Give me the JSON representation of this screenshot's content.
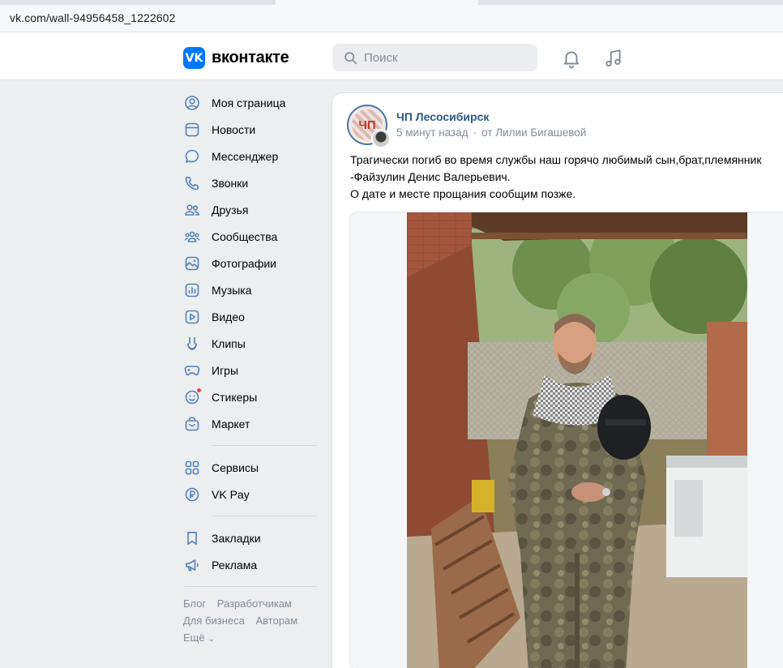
{
  "browser": {
    "url": "vk.com/wall-94956458_1222602"
  },
  "header": {
    "logo_mark": "VK",
    "logo_text": "вконтакте",
    "search_placeholder": "Поиск"
  },
  "sidebar": {
    "items": [
      {
        "label": "Моя страница",
        "icon": "user-circle-icon"
      },
      {
        "label": "Новости",
        "icon": "news-icon"
      },
      {
        "label": "Мессенджер",
        "icon": "message-icon"
      },
      {
        "label": "Звонки",
        "icon": "phone-icon"
      },
      {
        "label": "Друзья",
        "icon": "friends-icon"
      },
      {
        "label": "Сообщества",
        "icon": "communities-icon"
      },
      {
        "label": "Фотографии",
        "icon": "photo-icon"
      },
      {
        "label": "Музыка",
        "icon": "music-bars-icon"
      },
      {
        "label": "Видео",
        "icon": "video-icon"
      },
      {
        "label": "Клипы",
        "icon": "clips-icon"
      },
      {
        "label": "Игры",
        "icon": "gamepad-icon"
      },
      {
        "label": "Стикеры",
        "icon": "sticker-icon"
      },
      {
        "label": "Маркет",
        "icon": "market-bag-icon"
      }
    ],
    "items2": [
      {
        "label": "Сервисы",
        "icon": "services-grid-icon"
      },
      {
        "label": "VK Pay",
        "icon": "vkpay-icon"
      }
    ],
    "items3": [
      {
        "label": "Закладки",
        "icon": "bookmark-icon"
      },
      {
        "label": "Реклама",
        "icon": "megaphone-icon"
      }
    ],
    "footer": {
      "blog": "Блог",
      "developers": "Разработчикам",
      "business": "Для бизнеса",
      "authors": "Авторам",
      "more": "Ещё"
    }
  },
  "post": {
    "group_name": "ЧП Лесосибирск",
    "avatar_text": "ЧП",
    "time": "5 минут назад",
    "author": "от Лилии Бигашевой",
    "text_lines": [
      "Трагически погиб во время службы наш горячо любимый сын,брат,племянник",
      "-Файзулин Денис Валерьевич.",
      "О дате и месте прощания сообщим позже."
    ]
  },
  "colors": {
    "accent": "#0077ff",
    "link": "#2a5885",
    "secondary_text": "#818c99",
    "page_bg": "#edeef0"
  }
}
